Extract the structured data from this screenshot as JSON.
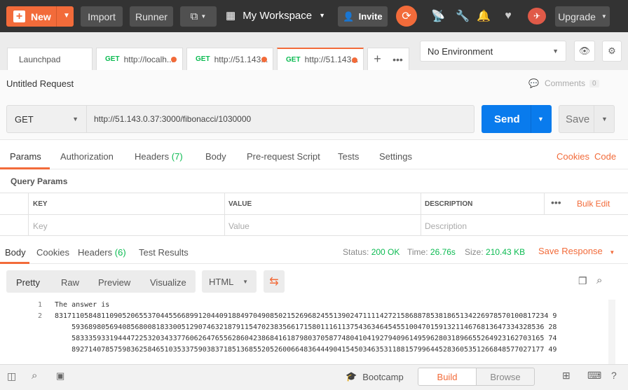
{
  "topbar": {
    "new_label": "New",
    "import_label": "Import",
    "runner_label": "Runner",
    "workspace_label": "My Workspace",
    "invite_label": "Invite",
    "upgrade_label": "Upgrade"
  },
  "tabs": [
    {
      "label": "Launchpad",
      "method": ""
    },
    {
      "label": "http://localh...",
      "method": "GET"
    },
    {
      "label": "http://51.143...",
      "method": "GET"
    },
    {
      "label": "http://51.143...",
      "method": "GET"
    }
  ],
  "environment": {
    "selected": "No Environment"
  },
  "request": {
    "title": "Untitled Request",
    "comments_label": "Comments",
    "comments_count": "0",
    "method": "GET",
    "url": "http://51.143.0.37:3000/fibonacci/1030000",
    "send_label": "Send",
    "save_label": "Save"
  },
  "request_tabs": {
    "params": "Params",
    "authorization": "Authorization",
    "headers": "Headers",
    "headers_count": "(7)",
    "body": "Body",
    "prerequest": "Pre-request Script",
    "tests": "Tests",
    "settings": "Settings",
    "cookies": "Cookies",
    "code": "Code"
  },
  "query_params": {
    "title": "Query Params",
    "col_key": "KEY",
    "col_value": "VALUE",
    "col_description": "DESCRIPTION",
    "bulk_edit": "Bulk Edit",
    "ph_key": "Key",
    "ph_value": "Value",
    "ph_description": "Description"
  },
  "response": {
    "tabs": {
      "body": "Body",
      "cookies": "Cookies",
      "headers": "Headers",
      "headers_count": "(6)",
      "test_results": "Test Results"
    },
    "status_label": "Status:",
    "status_value": "200 OK",
    "time_label": "Time:",
    "time_value": "26.76s",
    "size_label": "Size:",
    "size_value": "210.43 KB",
    "save_response": "Save Response",
    "views": {
      "pretty": "Pretty",
      "raw": "Raw",
      "preview": "Preview",
      "visualize": "Visualize"
    },
    "format": "HTML",
    "lines": [
      {
        "n": "1",
        "text": "The answer is"
      },
      {
        "n": "2",
        "text": "831711058481109052065537044556689912044091884970490850215269682455139024711114272158688785381865134226978570100817234 9"
      },
      {
        "n": "",
        "text": "    5936898056940856800818330051290746321879115470238356617158011161137543634645455100470159132114676813647334328536 28"
      },
      {
        "n": "",
        "text": "    5833359331944472253203433776062647655628604238684161879803705877480410419279409614959628031896655264923162703165 74"
      },
      {
        "n": "",
        "text": "    8927140785759836258465103533759038371851368552052600664836444904154503463531188157996445283605351266848577027177 49"
      }
    ]
  },
  "statusbar": {
    "bootcamp": "Bootcamp",
    "build": "Build",
    "browse": "Browse"
  }
}
